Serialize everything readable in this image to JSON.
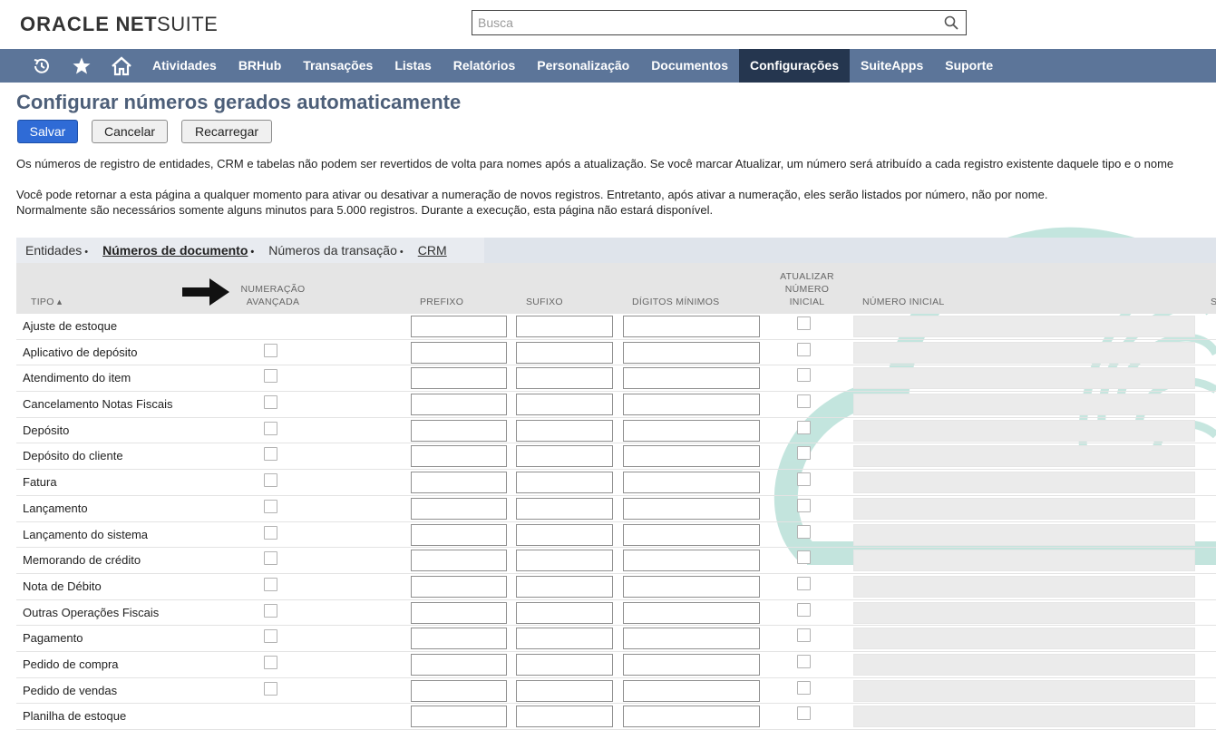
{
  "brand": {
    "logo_part1": "ORACLE",
    "logo_part2": "NET",
    "logo_part3": "SUITE"
  },
  "search": {
    "placeholder": "Busca"
  },
  "nav": {
    "items": [
      {
        "label": "Atividades",
        "active": false
      },
      {
        "label": "BRHub",
        "active": false
      },
      {
        "label": "Transações",
        "active": false
      },
      {
        "label": "Listas",
        "active": false
      },
      {
        "label": "Relatórios",
        "active": false
      },
      {
        "label": "Personalização",
        "active": false
      },
      {
        "label": "Documentos",
        "active": false
      },
      {
        "label": "Configurações",
        "active": true
      },
      {
        "label": "SuiteApps",
        "active": false
      },
      {
        "label": "Suporte",
        "active": false
      }
    ],
    "icons": [
      "recent-records-icon",
      "star-icon",
      "home-icon"
    ]
  },
  "page": {
    "title": "Configurar números gerados automaticamente",
    "buttons": {
      "save": "Salvar",
      "cancel": "Cancelar",
      "reload": "Recarregar"
    },
    "info1": "Os números de registro de entidades, CRM e tabelas não podem ser revertidos de volta para nomes após a atualização. Se você marcar Atualizar, um número será atribuído a cada registro existente daquele tipo e o nome",
    "info2": "Você pode retornar a esta página a qualquer momento para ativar ou desativar a numeração de novos registros. Entretanto, após ativar a numeração, eles serão listados por número, não por nome.",
    "info3": "Normalmente são necessários somente alguns minutos para 5.000 registros. Durante a execução, esta página não estará disponível."
  },
  "tabs": [
    {
      "label": "Entidades",
      "dot": "•",
      "active": false
    },
    {
      "label": "Números de documento",
      "dot": "•",
      "active": true
    },
    {
      "label": "Números da transação",
      "dot": "•",
      "active": false
    },
    {
      "label": "CRM",
      "dot": "",
      "active": false
    }
  ],
  "table": {
    "headers": {
      "tipo": "TIPO ▴",
      "adv_line1": "NUMERAÇÃO",
      "adv_line2": "AVANÇADA",
      "prefixo": "PREFIXO",
      "sufixo": "SUFIXO",
      "digitos": "DÍGITOS MÍNIMOS",
      "upd_line1": "ATUALIZAR",
      "upd_line2": "NÚMERO",
      "upd_line3": "INICIAL",
      "inicial": "NÚMERO INICIAL",
      "extra": "S"
    },
    "rows": [
      {
        "label": "Ajuste de estoque",
        "advanced": false
      },
      {
        "label": "Aplicativo de depósito",
        "advanced": true
      },
      {
        "label": "Atendimento do item",
        "advanced": true
      },
      {
        "label": "Cancelamento Notas Fiscais",
        "advanced": true
      },
      {
        "label": "Depósito",
        "advanced": true
      },
      {
        "label": "Depósito do cliente",
        "advanced": true
      },
      {
        "label": "Fatura",
        "advanced": true
      },
      {
        "label": "Lançamento",
        "advanced": true
      },
      {
        "label": "Lançamento do sistema",
        "advanced": true
      },
      {
        "label": "Memorando de crédito",
        "advanced": true
      },
      {
        "label": "Nota de Débito",
        "advanced": true
      },
      {
        "label": "Outras Operações Fiscais",
        "advanced": true
      },
      {
        "label": "Pagamento",
        "advanced": true
      },
      {
        "label": "Pedido de compra",
        "advanced": true
      },
      {
        "label": "Pedido de vendas",
        "advanced": true
      },
      {
        "label": "Planilha de estoque",
        "advanced": false
      }
    ]
  },
  "colors": {
    "nav_bg": "#5c7599",
    "nav_active": "#25364f",
    "title": "#4d5f79",
    "primary_button": "#2f6bd6",
    "watermark": "#b9e0d8"
  }
}
